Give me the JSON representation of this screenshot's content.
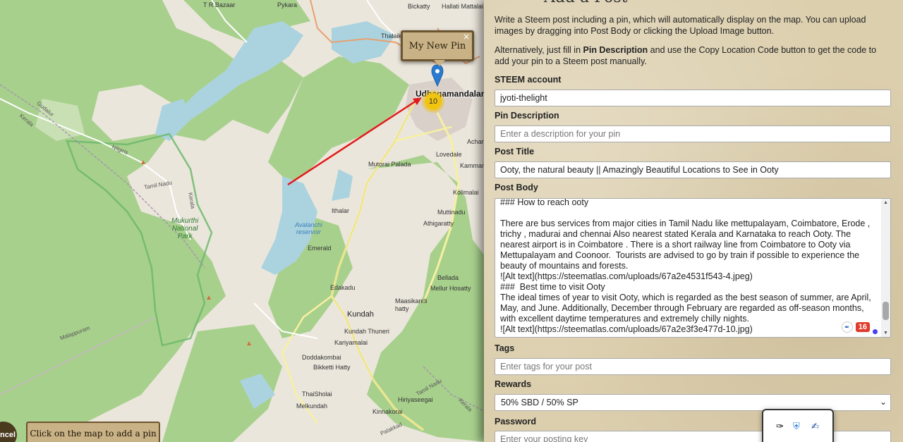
{
  "map": {
    "pin_popup": {
      "label": "My New Pin",
      "close": "×"
    },
    "cluster_count": "10",
    "add_pin_hint": "Click on the map to add a pin",
    "cancel_label": "ncel",
    "labels": {
      "tr_bazaar": "T R Bazaar",
      "pykara": "Pykara",
      "bickatty": "Bickatty",
      "hallati": "Hallati Mattalai",
      "thalaik": "Thalaik",
      "udhagamandalam": "Udhagamandalam",
      "kerala_nw": "Kerala",
      "gudalur": "Gudalur",
      "nilgiris": "Nilgiris",
      "tamil_nadu": "Tamil Nadu",
      "kerala_v": "Kerala",
      "mukurthi": "Mukurthi\nNational\nPark",
      "lovedale": "Lovedale",
      "achana": "Achana",
      "kammand": "Kamman",
      "mutorai": "Mutorai Palada",
      "kolimalai": "Kolimalai",
      "ithalar": "Ithalar",
      "muttinadu": "Muttinadu",
      "avalanchi": "Avalanchi\nreservoir",
      "athigaratty": "Athigaratty",
      "emerald": "Emerald",
      "bellada": "Bellada",
      "mellur": "Mellur Hosatty",
      "edakadu": "Edakadu",
      "maasikandi": "Maasikandi\nhatty",
      "kundah": "Kundah",
      "kundah_thuneri": "Kundah Thuneri",
      "kariyamalai": "Kariyamalai",
      "malappuram": "Malappuram",
      "doddakombai": "Doddakombai",
      "bikketti": "Bikketti Hatty",
      "thaisholai": "ThaiSholai",
      "hiriyaseegai": "Hiriyaseegai",
      "melkundah": "Melkundah",
      "kinnakorai": "Kinnakorai",
      "tamil_nadu_s": "Tamil Nadu",
      "kerala_se": "Kerala",
      "palakkad": "Palakkad"
    }
  },
  "panel": {
    "heading": "Add a Post",
    "intro": "Write a Steem post including a pin, which will automatically display on the map. You can upload images by dragging into Post Body or clicking the Upload Image button.",
    "intro2_pre": "Alternatively, just fill in ",
    "intro2_bold": "Pin Description",
    "intro2_post": " and use the Copy Location Code button to get the code to add your pin to a Steem post manually.",
    "steem_account_label": "STEEM account",
    "steem_account_value": "jyoti-thelight",
    "pin_description_label": "Pin Description",
    "pin_description_placeholder": "Enter a description for your pin",
    "post_title_label": "Post Title",
    "post_title_value": "Ooty, the natural beauty || Amazingly Beautiful Locations to See in Ooty",
    "post_body_label": "Post Body",
    "post_body_value": "### How to reach ooty\n\nThere are bus services from major cities in Tamil Nadu like mettupalayam, Coimbatore, Erode , trichy , madurai and chennai Also nearest stated Kerala and Karnataka to reach Ooty. The nearest airport is in Coimbatore . There is a short railway line from Coimbatore to Ooty via Mettupalayam and Coonoor.  Tourists are advised to go by train if possible to experience the beauty of mountains and forests.\n![Alt text](https://steematlas.com/uploads/67a2e4531f543-4.jpeg)\n###  Best time to visit Ooty\nThe ideal times of year to visit Ooty, which is regarded as the best season of summer, are April, May, and June. Additionally, December through February are regarded as off-season months, with excellent daytime temperatures and extremely chilly nights.\n![Alt text](https://steematlas.com/uploads/67a2e3f3e477d-10.jpg)",
    "grammar_count": "16",
    "tags_label": "Tags",
    "tags_placeholder": "Enter tags for your post",
    "rewards_label": "Rewards",
    "rewards_value": "50% SBD / 50% SP",
    "password_label": "Password",
    "password_placeholder": "Enter your posting key"
  },
  "colors": {
    "forest": "#a8d08d",
    "land": "#ebe6dc",
    "water": "#aad3df",
    "arrow": "#e31a1a",
    "pin_marker": "#2a7ad2",
    "cluster": "#f1c40f",
    "panel_bg": "#dccfae"
  }
}
